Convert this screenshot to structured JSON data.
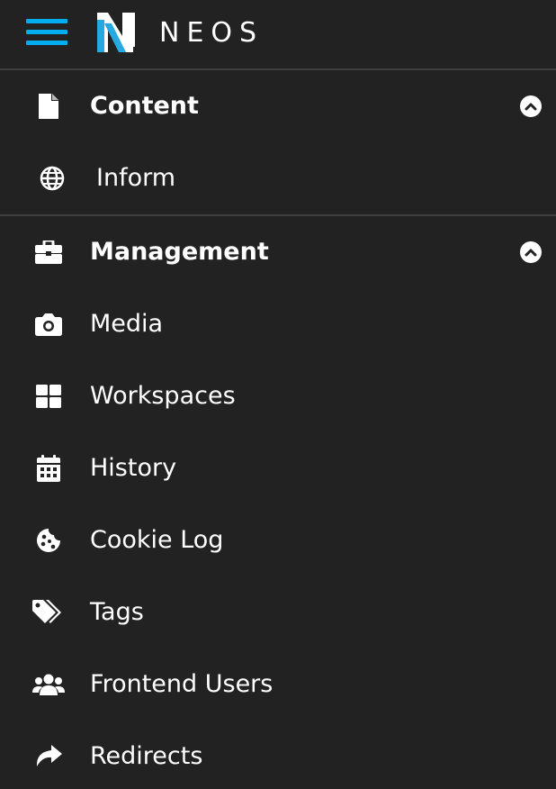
{
  "header": {
    "menu_icon": "hamburger-icon",
    "brand": "NEOS",
    "accent": "#00adee"
  },
  "sections": [
    {
      "title": "Content",
      "icon": "file-icon",
      "expanded": true,
      "items": [
        {
          "label": "Inform",
          "icon": "globe-icon"
        }
      ]
    },
    {
      "title": "Management",
      "icon": "briefcase-icon",
      "expanded": true,
      "items": [
        {
          "label": "Media",
          "icon": "camera-icon"
        },
        {
          "label": "Workspaces",
          "icon": "th-large-icon"
        },
        {
          "label": "History",
          "icon": "calendar-icon"
        },
        {
          "label": "Cookie Log",
          "icon": "cookie-icon"
        },
        {
          "label": "Tags",
          "icon": "tags-icon"
        },
        {
          "label": "Frontend Users",
          "icon": "users-icon"
        },
        {
          "label": "Redirects",
          "icon": "share-icon"
        }
      ]
    }
  ]
}
